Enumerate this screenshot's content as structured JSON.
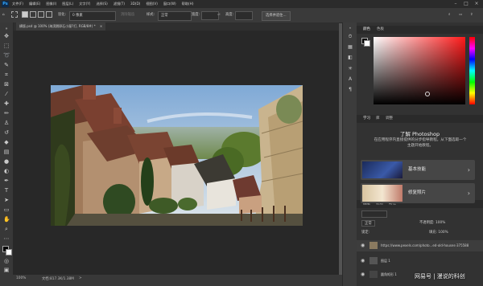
{
  "menubar": {
    "logo": "Ps",
    "menus": [
      "文件(F)",
      "编辑(E)",
      "图像(I)",
      "图层(L)",
      "文字(Y)",
      "选择(S)",
      "滤镜(T)",
      "3D(D)",
      "视图(V)",
      "窗口(W)",
      "帮助(H)"
    ]
  },
  "options": {
    "feather_label": "羽化:",
    "feather_value": "0 像素",
    "antialias_label": "消除锯齿",
    "style_label": "样式:",
    "style_value": "正常",
    "width_label": "宽度:",
    "height_label": "高度:",
    "select_subject": "选择并遮住..."
  },
  "document": {
    "tab_title": "横版.psd @ 100% (海滨鹅卵石小屋?打, RGB/8#) *",
    "tab_close": "×"
  },
  "status": {
    "zoom": "100%",
    "doc_info": "文档:817.3K/1.38M",
    "arrow": ">"
  },
  "panels": {
    "color_tabs": [
      "颜色",
      "色板"
    ],
    "learn_tabs": [
      "学习",
      "库",
      "调整"
    ],
    "learn_title": "了解 Photoshop",
    "learn_desc": "在应用程序内直接提供的分步指导教程。从下面选取一个主题开始教程。",
    "cards": [
      {
        "label": "基本技能"
      },
      {
        "label": "修复照片"
      }
    ],
    "layers_tabs": [
      "图层",
      "通道",
      "路径"
    ],
    "blend_mode": "正常",
    "opacity": "不透明度: 100%",
    "fill": "填充: 100%",
    "lock_label": "锁定:",
    "layers": [
      {
        "name": "https://www.pexels.com/photo...ed-old-houses-375588"
      },
      {
        "name": "图层 1"
      },
      {
        "name": "圆角矩形 1"
      }
    ]
  },
  "watermark": "网易号 | 漫说的科创",
  "chart_colors": {
    "app_bg": "#535353",
    "canvas_bg": "#282828",
    "panel_bg": "#323232",
    "accent": "#31a8ff"
  }
}
